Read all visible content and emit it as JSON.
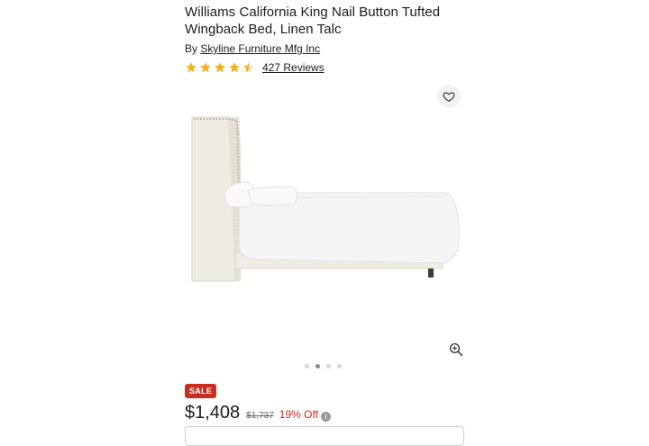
{
  "product": {
    "title": "Williams California King Nail Button Tufted Wingback Bed, Linen Talc",
    "by_prefix": "By",
    "brand": "Skyline Furniture Mfg Inc",
    "rating": 4.5,
    "reviews_label": "427 Reviews"
  },
  "gallery": {
    "image_alt": "Williams California King Nail Button Tufted Wingback Bed side view",
    "dots": 4,
    "active_dot": 1
  },
  "pricing": {
    "badge": "SALE",
    "price": "$1,408",
    "original_price": "$1,737",
    "discount": "19% Off"
  },
  "colors": {
    "star": "#f5b01c",
    "sale": "#cc2d1e"
  }
}
